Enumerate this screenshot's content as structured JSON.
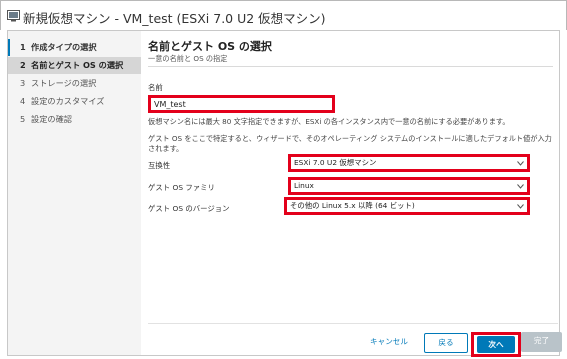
{
  "window": {
    "title": "新規仮想マシン - VM_test (ESXi 7.0 U2 仮想マシン)"
  },
  "steps": [
    {
      "num": "1",
      "label": "作成タイプの選択",
      "state": "completed"
    },
    {
      "num": "2",
      "label": "名前とゲスト OS の選択",
      "state": "active"
    },
    {
      "num": "3",
      "label": "ストレージの選択",
      "state": "pending"
    },
    {
      "num": "4",
      "label": "設定のカスタマイズ",
      "state": "pending"
    },
    {
      "num": "5",
      "label": "設定の確認",
      "state": "pending"
    }
  ],
  "main": {
    "heading": "名前とゲスト OS の選択",
    "subheading": "一意の名前と OS の指定",
    "name_label": "名前",
    "name_value": "VM_test",
    "help_text_1": "仮想マシン名には最大 80 文字指定できますが、ESXi の各インスタンス内で一意の名前にする必要があります。",
    "help_text_2a": "ゲスト OS をここで特定すると、ウィザードで、そのオペレーティング システムのインストールに適したデフォルト値が入力",
    "help_text_2b": "されます。",
    "compat_label": "互換性",
    "compat_value": "ESXi 7.0 U2 仮想マシン",
    "family_label": "ゲスト OS ファミリ",
    "family_value": "Linux",
    "version_label": "ゲスト OS のバージョン",
    "version_value": "その他の Linux 5.x 以降 (64 ビット)"
  },
  "footer": {
    "cancel": "キャンセル",
    "back": "戻る",
    "next": "次へ",
    "finish": "完了"
  },
  "colors": {
    "accent": "#0079b8",
    "highlight": "#e3001b",
    "disabled": "#b9c3c9"
  }
}
